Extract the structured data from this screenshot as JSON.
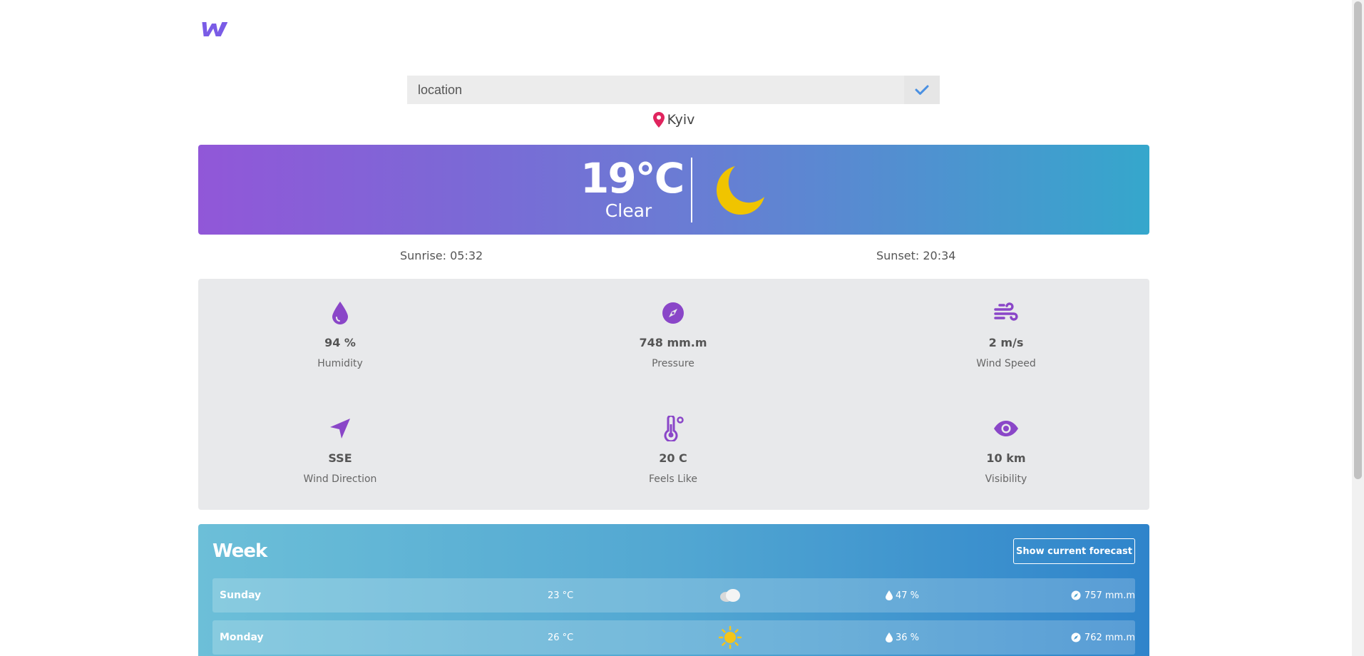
{
  "logo": {
    "letter": "w",
    "color": "#7a5ce6"
  },
  "search": {
    "placeholder": "location",
    "value": "",
    "confirm_icon": "check-icon"
  },
  "location": {
    "city": "Kyiv",
    "icon": "map-pin-icon",
    "icon_color": "#e0245e"
  },
  "current": {
    "temperature": "19°C",
    "condition": "Clear",
    "icon": "moon-icon",
    "icon_color": "#f0c400"
  },
  "sun": {
    "sunrise": "Sunrise: 05:32",
    "sunset": "Sunset: 20:34"
  },
  "details": [
    {
      "value": "94 %",
      "label": "Humidity",
      "icon": "droplet-icon"
    },
    {
      "value": "748 mm.m",
      "label": "Pressure",
      "icon": "compass-icon"
    },
    {
      "value": "2 m/s",
      "label": "Wind Speed",
      "icon": "wind-icon"
    },
    {
      "value": "SSE",
      "label": "Wind Direction",
      "icon": "location-arrow-icon"
    },
    {
      "value": "20 C",
      "label": "Feels Like",
      "icon": "thermometer-icon"
    },
    {
      "value": "10 km",
      "label": "Visibility",
      "icon": "eye-icon"
    }
  ],
  "accent_color": "#8a46c8",
  "week": {
    "title": "Week",
    "button_label": "Show current forecast",
    "days": [
      {
        "day": "Sunday",
        "temperature": "23 °C",
        "icon": "cloud-icon",
        "humidity": "47 %",
        "pressure": "757 mm.m"
      },
      {
        "day": "Monday",
        "temperature": "26 °C",
        "icon": "sun-icon",
        "humidity": "36 %",
        "pressure": "762 mm.m"
      }
    ]
  }
}
